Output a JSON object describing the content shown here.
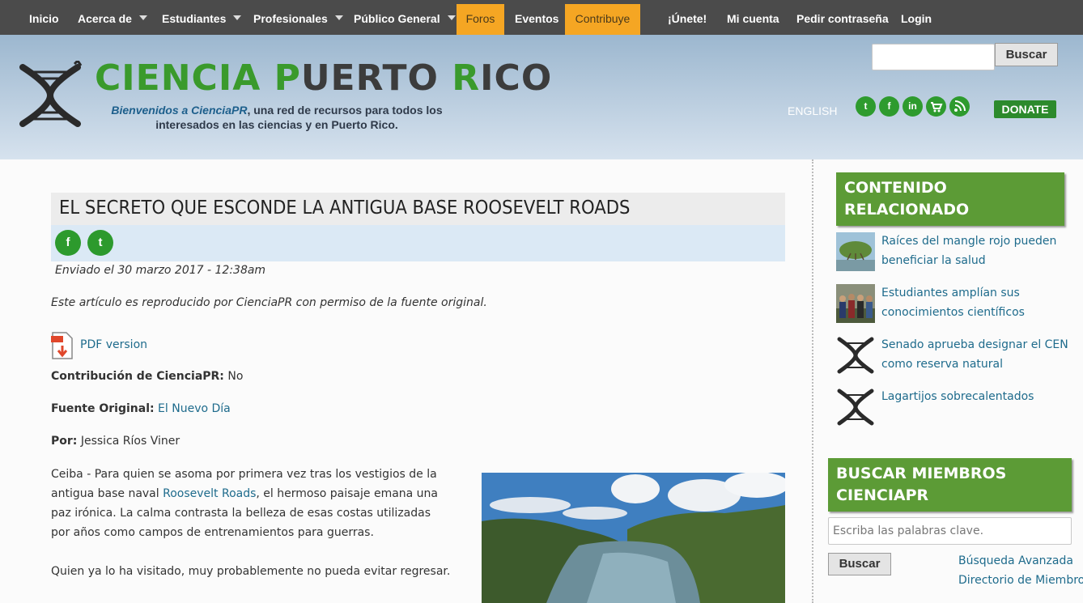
{
  "nav": {
    "items": [
      {
        "label": "Inicio"
      },
      {
        "label": "Acerca de"
      },
      {
        "label": "Estudiantes"
      },
      {
        "label": "Profesionales"
      },
      {
        "label": "Público General"
      },
      {
        "label": "Foros"
      },
      {
        "label": "Eventos"
      },
      {
        "label": "Contribuye"
      },
      {
        "label": "¡Únete!"
      },
      {
        "label": "Mi cuenta"
      },
      {
        "label": "Pedir contraseña"
      },
      {
        "label": "Login"
      }
    ],
    "highlight_color": "#f5a623"
  },
  "header": {
    "title_part1": "CIENCIA ",
    "title_p": "P",
    "title_part2": "UERTO ",
    "title_r": "R",
    "title_part3": "ICO",
    "tagline_em": "Bienvenidos a CienciaPR",
    "tagline_rest": ", una red de recursos para todos los interesados en las ciencias y en Puerto Rico.",
    "search_button": "Buscar",
    "language_link": "ENGLISH",
    "social_icons": [
      "twitter-icon",
      "facebook-icon",
      "linkedin-icon",
      "cart-icon",
      "rss-icon"
    ],
    "donate": "DONATE",
    "brand_green": "#3a9a2c"
  },
  "article": {
    "title": "EL SECRETO QUE ESCONDE LA ANTIGUA BASE ROOSEVELT ROADS",
    "share_icons": [
      "facebook-icon",
      "twitter-icon"
    ],
    "submitted": "Enviado el 30 marzo 2017 - 12:38am",
    "reproduced_note": "Este artículo es reproducido por CienciaPR con permiso de la fuente original.",
    "pdf_link": "PDF version",
    "contribution_label": "Contribución de CienciaPR:",
    "contribution_value": "No",
    "source_label": "Fuente Original:",
    "source_value": "El Nuevo Día",
    "author_label": "Por:",
    "author_value": "Jessica Ríos Viner",
    "p1_before": "Ceiba - Para quien se asoma por primera vez tras los vestigios de la antigua base naval ",
    "p1_link": "Roosevelt Roads",
    "p1_after": ", el hermoso paisaje emana una paz irónica. La calma contrasta la belleza de esas costas utilizadas por años como campos de entrenamientos para guerras.",
    "p2": "Quien ya lo ha visitado, muy probablemente no pueda evitar regresar."
  },
  "sidebar": {
    "related_heading": "CONTENIDO RELACIONADO",
    "related": [
      {
        "title": "Raíces del mangle rojo pueden beneficiar la salud",
        "thumb": "mangrove-photo"
      },
      {
        "title": "Estudiantes amplían sus conocimientos científicos",
        "thumb": "students-photo"
      },
      {
        "title": "Senado aprueba designar el CEN como reserva natural",
        "thumb": "cienciapr-logo"
      },
      {
        "title": "Lagartijos sobrecalentados",
        "thumb": "cienciapr-logo"
      }
    ],
    "members_heading": "BUSCAR MIEMBROS CIENCIAPR",
    "members_placeholder": "Escriba las palabras clave.",
    "members_button": "Buscar",
    "advanced_search": "Búsqueda Avanzada",
    "directory": "Directorio de Miembros"
  }
}
